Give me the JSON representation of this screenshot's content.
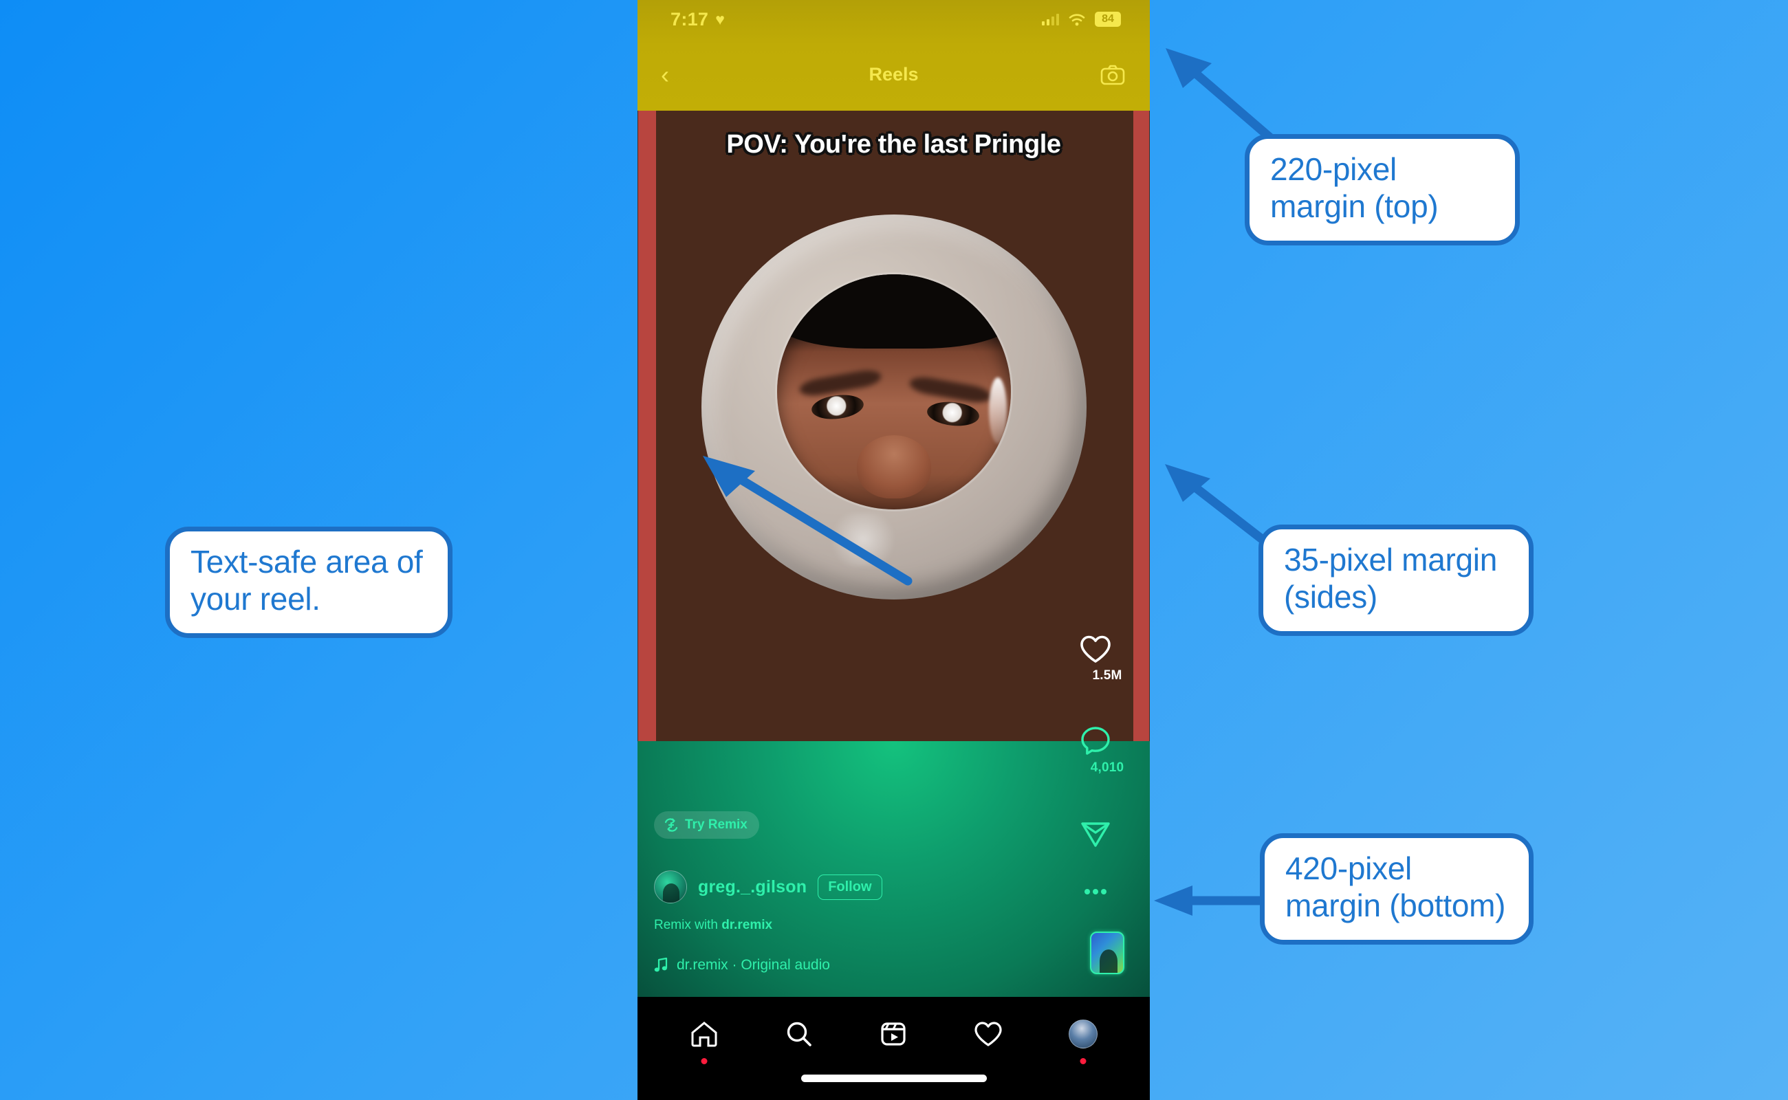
{
  "background": {
    "gradient_from": "#0e8df6",
    "gradient_to": "#56b2f6"
  },
  "phone": {
    "status_bar": {
      "time": "7:17",
      "heart_icon": "heart-icon",
      "signal_icon": "cellular-signal-icon",
      "wifi_icon": "wifi-icon",
      "battery_level": "84"
    },
    "header": {
      "back_icon": "chevron-left-icon",
      "title": "Reels",
      "camera_icon": "camera-icon"
    },
    "video": {
      "overlay_text": "POV: You're the last Pringle",
      "safe_bar_color": "#b8453f",
      "bottom_zone_color": "#0e9c6c"
    },
    "action_rail": [
      {
        "name": "like",
        "icon": "heart-icon",
        "count": "1.5M"
      },
      {
        "name": "comment",
        "icon": "comment-bubble-icon",
        "count": "4,010"
      },
      {
        "name": "share",
        "icon": "paper-plane-icon",
        "count": ""
      },
      {
        "name": "more",
        "icon": "ellipsis-icon",
        "count": ""
      },
      {
        "name": "audio-thumbnail",
        "icon": "audio-thumbnail-icon",
        "count": ""
      }
    ],
    "footer": {
      "try_remix_label": "Try Remix",
      "try_remix_icon": "remix-icon",
      "username": "greg._.gilson",
      "follow_label": "Follow",
      "remix_with_prefix": "Remix with ",
      "remix_with_name": "dr.remix",
      "audio_icon": "music-note-icon",
      "audio_label": "dr.remix · Original audio"
    },
    "navbar": [
      {
        "name": "home",
        "icon": "home-icon",
        "badge": true
      },
      {
        "name": "search",
        "icon": "search-icon",
        "badge": false
      },
      {
        "name": "reels",
        "icon": "reels-icon",
        "badge": false
      },
      {
        "name": "activity",
        "icon": "heart-icon",
        "badge": false
      },
      {
        "name": "profile",
        "icon": "profile-avatar-icon",
        "badge": true
      }
    ]
  },
  "callouts": {
    "top": "220-pixel margin (top)",
    "sides": "35-pixel margin (sides)",
    "bottom": "420-pixel margin (bottom)",
    "safe_area": "Text-safe area of your reel.",
    "border_color": "#1d6fc4",
    "text_color": "#1f78d0"
  }
}
